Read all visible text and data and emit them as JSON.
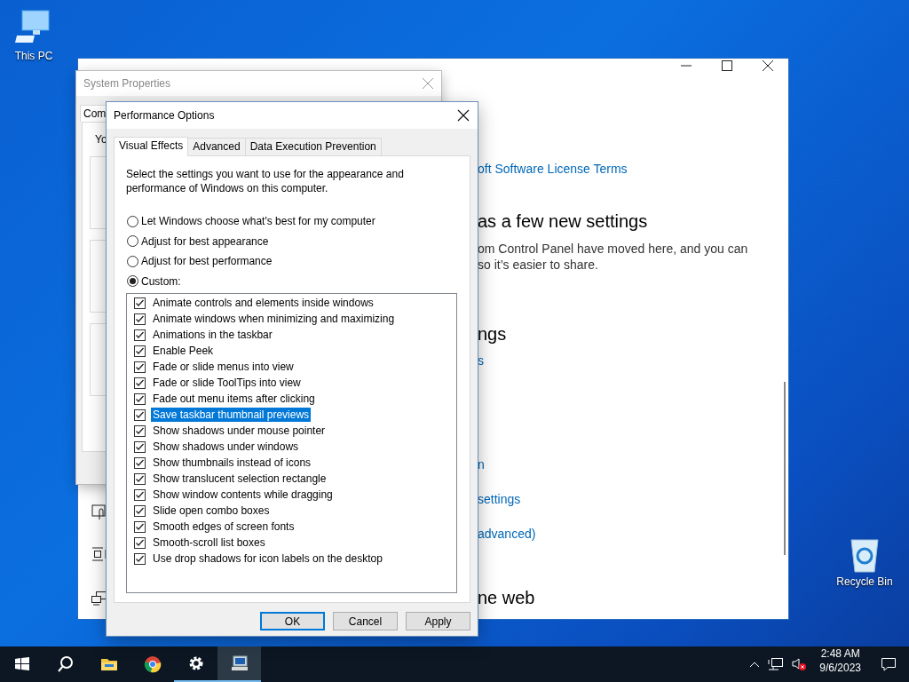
{
  "desktop_icons": [
    {
      "kind": "computer",
      "label": "This PC"
    },
    {
      "kind": "recycle",
      "label": "Recycle Bin"
    }
  ],
  "settings_window": {
    "texts": [
      {
        "kind": "link",
        "text": "oft Software License Terms"
      },
      {
        "kind": "heading",
        "text": "as a few new settings"
      },
      {
        "kind": "body",
        "text": "om Control Panel have moved here, and you can"
      },
      {
        "kind": "body",
        "text": "so it’s easier to share."
      },
      {
        "kind": "heading",
        "text": "ngs"
      },
      {
        "kind": "link",
        "text": "s"
      },
      {
        "kind": "link",
        "text": "n"
      },
      {
        "kind": "link",
        "text": "settings"
      },
      {
        "kind": "link",
        "text": "advanced)"
      },
      {
        "kind": "heading",
        "text": "ne web"
      }
    ]
  },
  "system_properties": {
    "title": "System Properties",
    "tabs": [
      {
        "label": "Com",
        "selected": true
      }
    ],
    "intro": "Yo"
  },
  "performance_options": {
    "title": "Performance Options",
    "tabs": [
      {
        "label": "Visual Effects",
        "selected": true
      },
      {
        "label": "Advanced",
        "selected": false
      },
      {
        "label": "Data Execution Prevention",
        "selected": false
      }
    ],
    "description": "Select the settings you want to use for the appearance and performance of Windows on this computer.",
    "radios": [
      {
        "label": "Let Windows choose what's best for my computer",
        "selected": false
      },
      {
        "label": "Adjust for best appearance",
        "selected": false
      },
      {
        "label": "Adjust for best performance",
        "selected": false
      },
      {
        "label": "Custom:",
        "selected": true
      }
    ],
    "effects": [
      {
        "label": "Animate controls and elements inside windows",
        "checked": true,
        "selected": false
      },
      {
        "label": "Animate windows when minimizing and maximizing",
        "checked": true,
        "selected": false
      },
      {
        "label": "Animations in the taskbar",
        "checked": true,
        "selected": false
      },
      {
        "label": "Enable Peek",
        "checked": true,
        "selected": false
      },
      {
        "label": "Fade or slide menus into view",
        "checked": true,
        "selected": false
      },
      {
        "label": "Fade or slide ToolTips into view",
        "checked": true,
        "selected": false
      },
      {
        "label": "Fade out menu items after clicking",
        "checked": true,
        "selected": false
      },
      {
        "label": "Save taskbar thumbnail previews",
        "checked": true,
        "selected": true
      },
      {
        "label": "Show shadows under mouse pointer",
        "checked": true,
        "selected": false
      },
      {
        "label": "Show shadows under windows",
        "checked": true,
        "selected": false
      },
      {
        "label": "Show thumbnails instead of icons",
        "checked": true,
        "selected": false
      },
      {
        "label": "Show translucent selection rectangle",
        "checked": true,
        "selected": false
      },
      {
        "label": "Show window contents while dragging",
        "checked": true,
        "selected": false
      },
      {
        "label": "Slide open combo boxes",
        "checked": true,
        "selected": false
      },
      {
        "label": "Smooth edges of screen fonts",
        "checked": true,
        "selected": false
      },
      {
        "label": "Smooth-scroll list boxes",
        "checked": true,
        "selected": false
      },
      {
        "label": "Use drop shadows for icon labels on the desktop",
        "checked": true,
        "selected": false
      }
    ],
    "buttons": [
      {
        "label": "OK",
        "default": true
      },
      {
        "label": "Cancel",
        "default": false
      },
      {
        "label": "Apply",
        "default": false
      }
    ]
  },
  "taskbar": {
    "apps": [
      {
        "kind": "start",
        "running": false,
        "selected": false
      },
      {
        "kind": "search",
        "running": false,
        "selected": false
      },
      {
        "kind": "folder",
        "running": false,
        "selected": false
      },
      {
        "kind": "browser",
        "running": false,
        "selected": false
      },
      {
        "kind": "gear",
        "running": true,
        "selected": false
      },
      {
        "kind": "system",
        "running": true,
        "selected": true
      }
    ],
    "clock": {
      "time": "2:48 AM",
      "date": "9/6/2023"
    }
  }
}
